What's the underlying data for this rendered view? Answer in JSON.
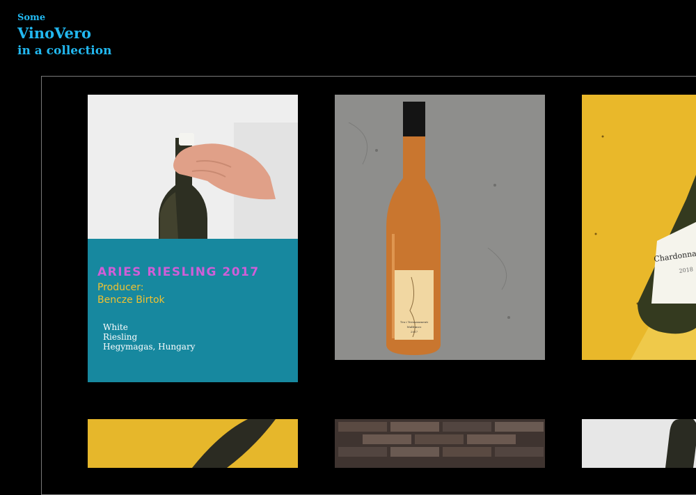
{
  "header": {
    "kicker": "Some",
    "brand": "VinoVero",
    "subtitle": "in a collection"
  },
  "cards": [
    {
      "title": "ARIES RIESLING 2017",
      "producer_label": "Producer:",
      "producer_name": "Bencze Birtok",
      "color": "White",
      "grape": "Riesling",
      "region": "Hegymagas, Hungary"
    },
    {
      "label_line1": "Tra i Terrazzamenti",
      "label_line2": "Malfranco",
      "label_year": "2017"
    },
    {
      "label_text": "Chardonnay",
      "label_year": "2018"
    }
  ],
  "colors": {
    "background": "#000000",
    "header_text": "#22b8f0",
    "info_panel": "#17889f",
    "title": "#cf5fd8",
    "producer": "#f2c230"
  }
}
